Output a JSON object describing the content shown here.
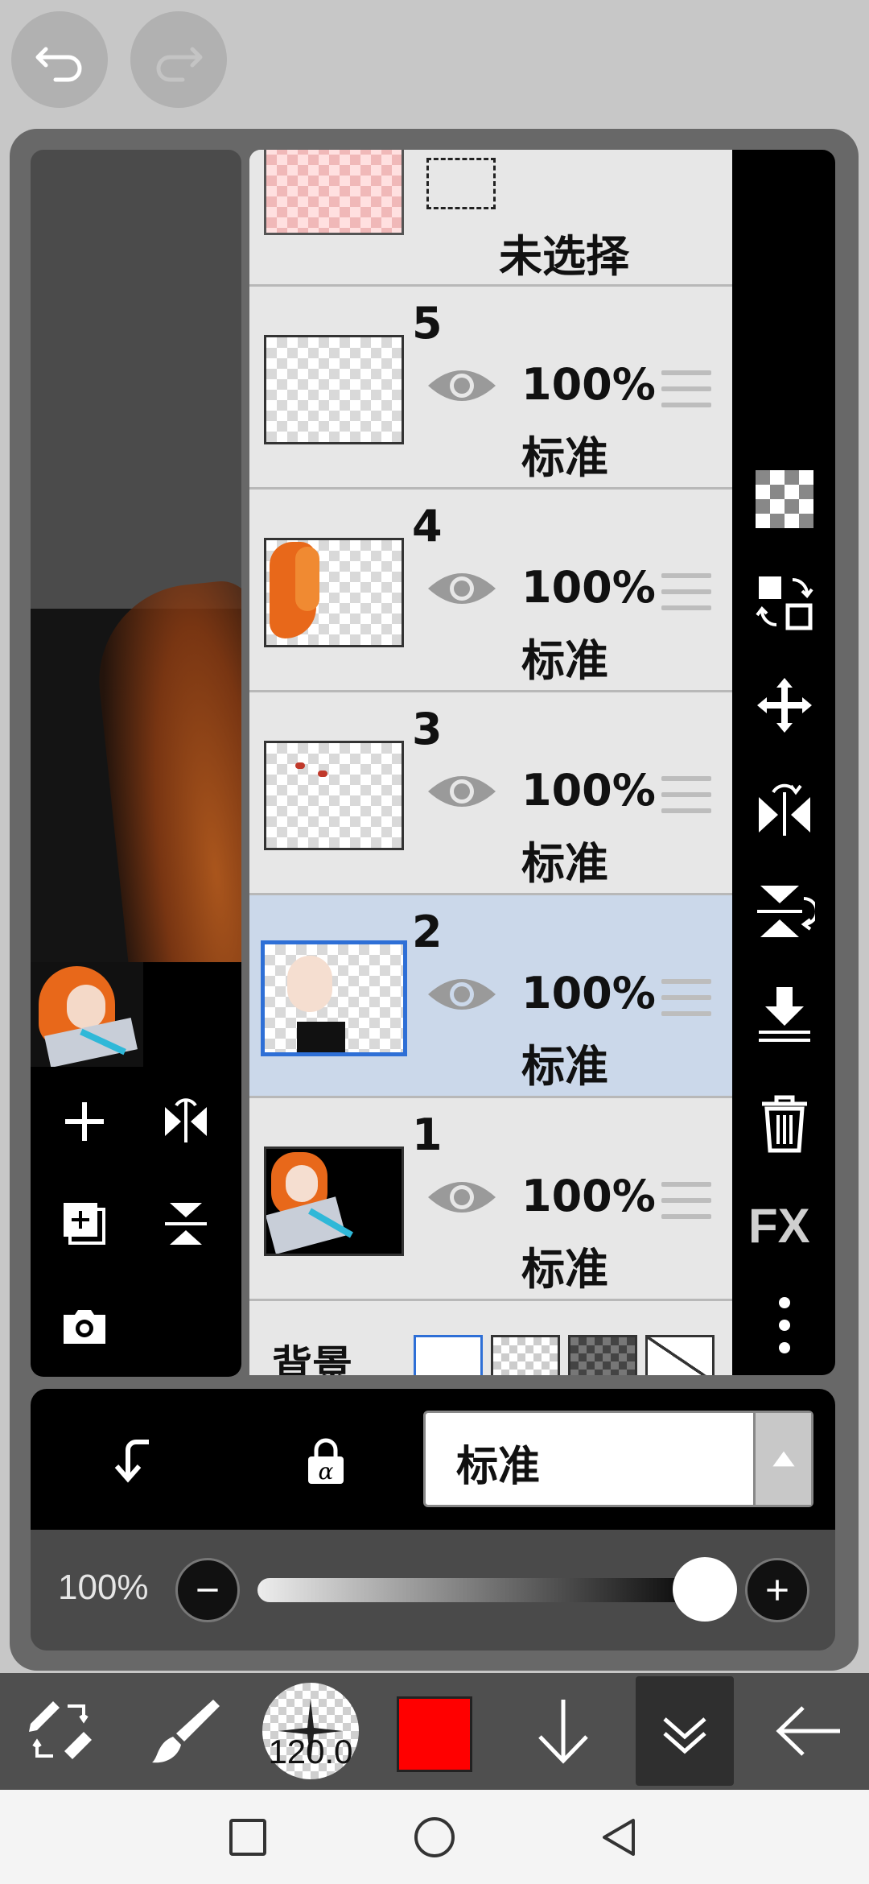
{
  "layers": {
    "unselected_label": "未选择",
    "items": [
      {
        "number": "5",
        "opacity": "100%",
        "mode": "标准"
      },
      {
        "number": "4",
        "opacity": "100%",
        "mode": "标准"
      },
      {
        "number": "3",
        "opacity": "100%",
        "mode": "标准"
      },
      {
        "number": "2",
        "opacity": "100%",
        "mode": "标准",
        "selected": true
      },
      {
        "number": "1",
        "opacity": "100%",
        "mode": "标准"
      }
    ],
    "background_label": "背景"
  },
  "right_tools": {
    "fx_label": "FX"
  },
  "blend": {
    "mode_value": "标准"
  },
  "opacity": {
    "label": "100%",
    "value_percent": 100
  },
  "toolbar": {
    "brush_size": "120.0",
    "color": "#ff0000"
  }
}
